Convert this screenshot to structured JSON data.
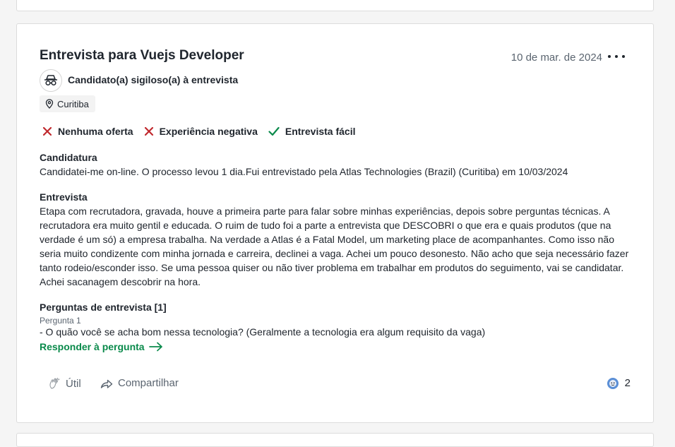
{
  "review": {
    "title": "Entrevista para Vuejs Developer",
    "date": "10 de mar. de 2024",
    "candidate": "Candidato(a) sigiloso(a) à entrevista",
    "location": "Curitiba",
    "flags": [
      {
        "label": "Nenhuma oferta",
        "icon": "x-icon",
        "color": "#c0282d"
      },
      {
        "label": "Experiência negativa",
        "icon": "x-icon",
        "color": "#c0282d"
      },
      {
        "label": "Entrevista fácil",
        "icon": "check-icon",
        "color": "#0a8a4b"
      }
    ],
    "application": {
      "heading": "Candidatura",
      "text": "Candidatei-me on-line. O processo levou 1 dia.Fui entrevistado pela Atlas Technologies (Brazil) (Curitiba) em 10/03/2024"
    },
    "interview": {
      "heading": "Entrevista",
      "text": "Etapa com recrutadora, gravada, houve a primeira parte para falar sobre minhas experiências, depois sobre perguntas técnicas. A recrutadora era muito gentil e educada. O ruim de tudo foi a parte a entrevista que DESCOBRI o que era e quais produtos (que na verdade é um só) a empresa trabalha. Na verdade a Atlas é a Fatal Model, um marketing place de acompanhantes. Como isso não seria muito condizente com minha jornada e carreira, declinei a vaga. Achei um pouco desonesto. Não acho que seja necessário fazer tanto rodeio/esconder isso. Se uma pessoa quiser ou não tiver problema em trabalhar em produtos do seguimento, vai se candidatar. Achei sacanagem descobrir na hora."
    },
    "questions": {
      "heading": "Perguntas de entrevista [1]",
      "question_label": "Pergunta 1",
      "question_text": "- O quão você se acha bom nessa tecnologia? (Geralmente a tecnologia era algum requisito da vaga)",
      "answer_link": "Responder à pergunta"
    },
    "footer": {
      "helpful": "Útil",
      "share": "Compartilhar",
      "reaction_count": "2"
    }
  },
  "colors": {
    "negative": "#c0282d",
    "positive": "#0a8a4b",
    "muted": "#5b6570"
  }
}
